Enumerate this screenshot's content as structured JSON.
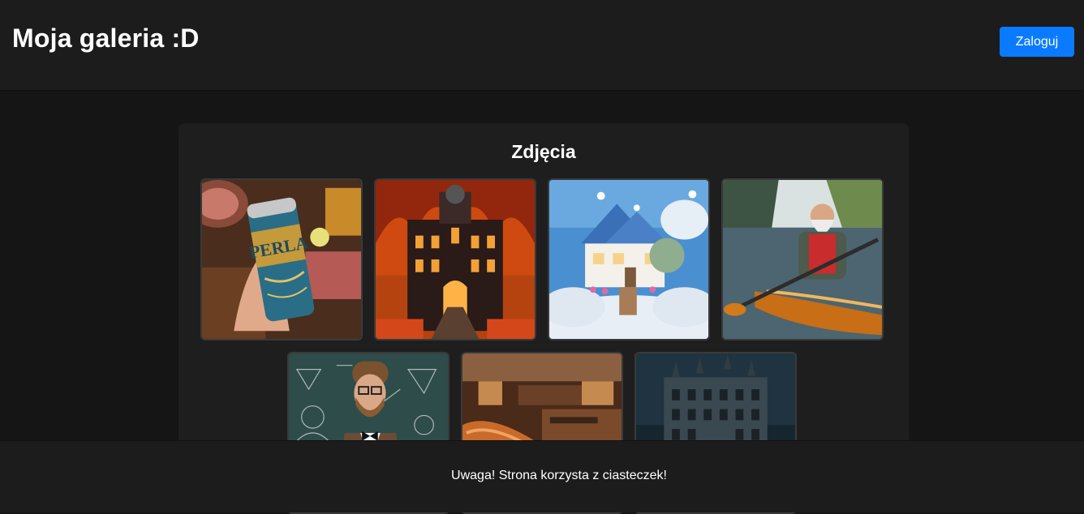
{
  "header": {
    "title": "Moja galeria :D",
    "login_label": "Zaloguj"
  },
  "gallery": {
    "title": "Zdjęcia",
    "images": [
      {
        "name": "beer-can-image",
        "label": "PERLA"
      },
      {
        "name": "burning-building-image"
      },
      {
        "name": "cloud-house-image"
      },
      {
        "name": "kayak-man-image"
      },
      {
        "name": "teacher-chalkboard-image"
      },
      {
        "name": "wooden-boat-shop-image"
      },
      {
        "name": "dark-castle-image"
      }
    ]
  },
  "cookie_banner": {
    "text": "Uwaga! Strona korzysta z ciasteczek!"
  }
}
